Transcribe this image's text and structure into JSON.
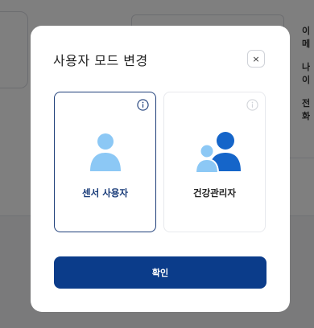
{
  "background": {
    "labels": [
      "이메",
      "나이",
      "전화"
    ]
  },
  "modal": {
    "title": "사용자 모드 변경",
    "close_label": "×",
    "options": [
      {
        "label": "센서 사용자",
        "icon": "single-person-icon",
        "selected": true
      },
      {
        "label": "건강관리자",
        "icon": "group-people-icon",
        "selected": false
      }
    ],
    "confirm_label": "확인"
  },
  "colors": {
    "primary": "#0b3c8a",
    "selected_border": "#1f3f7a",
    "icon_light": "#8cc8f5",
    "icon_dark": "#1565c9"
  }
}
